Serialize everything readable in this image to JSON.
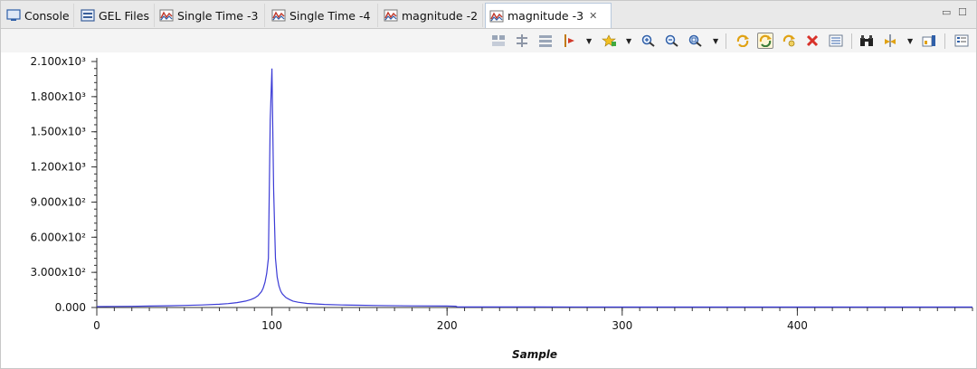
{
  "tabs": [
    {
      "label": "Console",
      "icon": "console-icon",
      "active": false
    },
    {
      "label": "GEL Files",
      "icon": "gel-files-icon",
      "active": false
    },
    {
      "label": "Single Time -3",
      "icon": "graph-icon",
      "active": false
    },
    {
      "label": "Single Time -4",
      "icon": "graph-icon",
      "active": false
    },
    {
      "label": "magnitude -2",
      "icon": "graph-icon",
      "active": false
    },
    {
      "label": "magnitude -3",
      "icon": "graph-icon",
      "active": true
    }
  ],
  "toolbar": {
    "buttons": [
      {
        "name": "align-icon"
      },
      {
        "name": "measure-icon"
      },
      {
        "name": "stack-icon"
      },
      {
        "name": "cursor-icon",
        "dropdown": true
      },
      {
        "name": "add-marker-icon",
        "dropdown": true
      },
      {
        "name": "zoom-in-icon"
      },
      {
        "name": "zoom-out-icon"
      },
      {
        "name": "zoom-fit-icon",
        "dropdown": true
      },
      {
        "name": "refresh-icon"
      },
      {
        "name": "continuous-refresh-icon",
        "pressed": true
      },
      {
        "name": "auto-refresh-icon"
      },
      {
        "name": "delete-icon"
      },
      {
        "name": "properties-icon"
      },
      {
        "name": "binoculars-icon"
      },
      {
        "name": "import-icon",
        "dropdown": true
      },
      {
        "name": "export-icon"
      },
      {
        "name": "menu-icon"
      }
    ]
  },
  "chart_data": {
    "type": "line",
    "title": "",
    "xlabel": "Sample",
    "ylabel": "",
    "xlim": [
      0,
      500
    ],
    "ylim": [
      0,
      2100
    ],
    "grid": false,
    "x_ticks": [
      0,
      100,
      200,
      300,
      400
    ],
    "y_ticks": [
      {
        "value": 0,
        "label": "0.000"
      },
      {
        "value": 300,
        "label": "3.000x10²"
      },
      {
        "value": 600,
        "label": "6.000x10²"
      },
      {
        "value": 900,
        "label": "9.000x10²"
      },
      {
        "value": 1200,
        "label": "1.200x10³"
      },
      {
        "value": 1500,
        "label": "1.500x10³"
      },
      {
        "value": 1800,
        "label": "1.800x10³"
      },
      {
        "value": 2100,
        "label": "2.100x10³"
      }
    ],
    "series": [
      {
        "color": "#3b3bd6",
        "x": [
          0,
          10,
          20,
          30,
          40,
          50,
          60,
          70,
          75,
          80,
          85,
          88,
          90,
          92,
          94,
          95,
          96,
          97,
          98,
          99,
          100,
          101,
          102,
          103,
          104,
          105,
          106,
          108,
          110,
          112,
          115,
          120,
          130,
          140,
          150,
          160,
          180,
          200,
          205,
          206,
          210,
          250,
          300,
          350,
          400,
          450,
          500
        ],
        "y": [
          8,
          9,
          10,
          12,
          15,
          18,
          22,
          28,
          33,
          42,
          55,
          68,
          80,
          100,
          135,
          165,
          215,
          290,
          420,
          1600,
          2040,
          1000,
          420,
          260,
          185,
          140,
          115,
          85,
          68,
          55,
          45,
          35,
          26,
          22,
          19,
          17,
          14,
          12,
          11,
          5,
          5,
          5,
          4,
          4,
          4,
          4,
          4
        ]
      }
    ]
  }
}
